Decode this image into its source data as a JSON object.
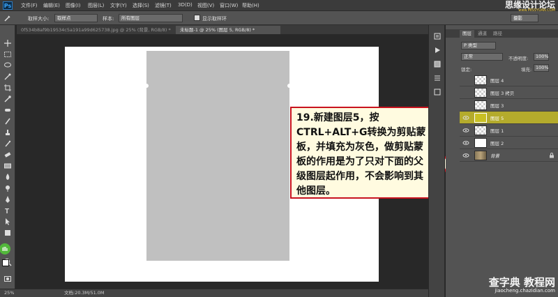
{
  "app": {
    "logo": "Ps"
  },
  "menu": [
    "文件(F)",
    "编辑(E)",
    "图像(I)",
    "图层(L)",
    "文字(Y)",
    "选择(S)",
    "滤镜(T)",
    "3D(D)",
    "视图(V)",
    "窗口(W)",
    "帮助(H)"
  ],
  "watermark_top": {
    "main": "思缘设计论坛",
    "sub": "www.MISSYUAN.COM"
  },
  "options": {
    "sample_size_label": "取样大小:",
    "sample_size_value": "取样点",
    "sample_label": "样本:",
    "sample_value": "所有图层",
    "show_ring_label": "显示取样环",
    "workspace": "摄影"
  },
  "tabs": [
    {
      "label": "0f534b8af9b19534c5a191a99d625738.jpg @ 25% (背景, RGB/8) *"
    },
    {
      "label": "未标题-1 @ 25% (图层 5, RGB/8) *"
    }
  ],
  "callout": {
    "text": "19.新建图层5，按CTRL+ALT+G转换为剪贴蒙板，并填充为灰色，做剪贴蒙板的作用是为了只对下面的父级图层起作用，不会影响到其他图层。",
    "border_color": "#c8121e"
  },
  "status": {
    "zoom": "25%",
    "doc": "文档:20.3M/51.0M"
  },
  "layers_panel": {
    "tabs": [
      "图层",
      "通道",
      "路径"
    ],
    "filter": "P 类型",
    "blend_mode": "正常",
    "opacity_label": "不透明度:",
    "opacity": "100%",
    "lock_label": "锁定:",
    "fill_label": "填充:",
    "fill": "100%",
    "layers": [
      {
        "name": "图层 4",
        "visible": false,
        "thumb": "checker",
        "selected": false
      },
      {
        "name": "图层 3 拷贝",
        "visible": false,
        "thumb": "checker",
        "selected": false
      },
      {
        "name": "图层 3",
        "visible": false,
        "thumb": "checker",
        "selected": false
      },
      {
        "name": "图层 5",
        "visible": true,
        "thumb": "olive",
        "selected": true
      },
      {
        "name": "图层 1",
        "visible": true,
        "thumb": "checker",
        "selected": false
      },
      {
        "name": "图层 2",
        "visible": true,
        "thumb": "white",
        "selected": false
      },
      {
        "name": "背景",
        "visible": true,
        "thumb": "photo",
        "selected": false
      }
    ]
  },
  "watermark_bottom": {
    "main": "查字典 教程网",
    "sub": "jiaocheng.chazidian.com"
  },
  "colors": {
    "accent": "#b4ab2c",
    "canvas_gray": "#c0c0c0"
  }
}
